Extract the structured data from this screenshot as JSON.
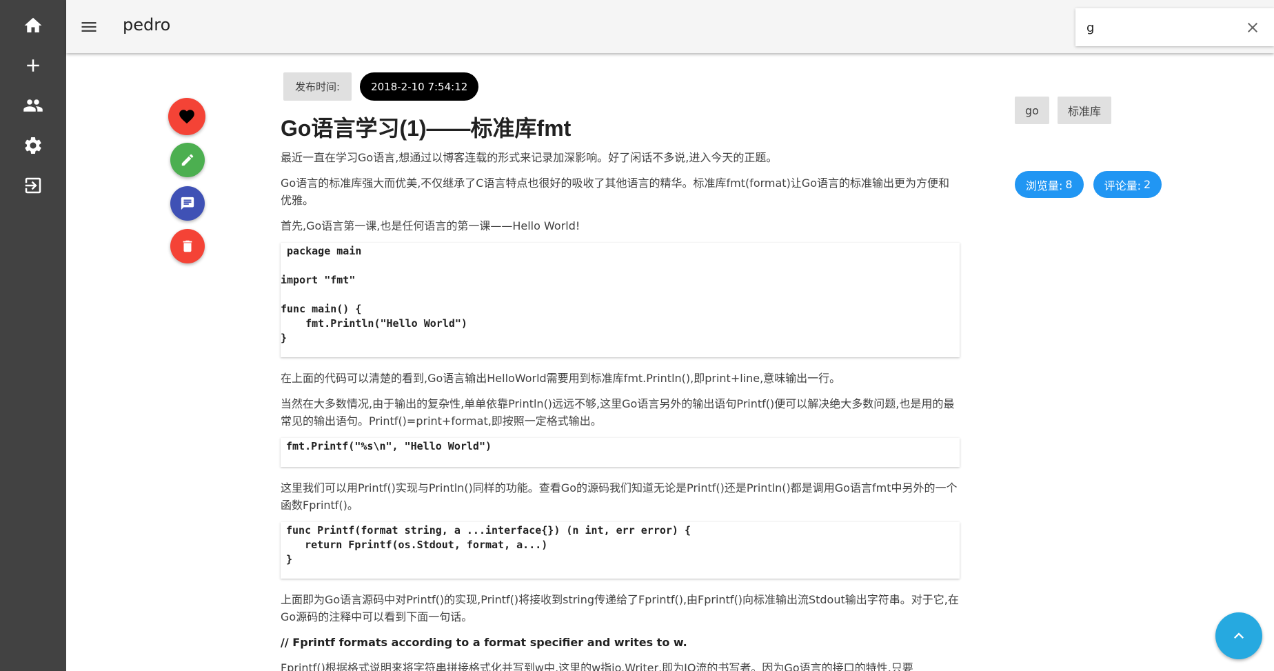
{
  "sidebar": {
    "items": [
      {
        "name": "home",
        "icon": "home-icon"
      },
      {
        "name": "add",
        "icon": "plus-icon"
      },
      {
        "name": "users",
        "icon": "people-icon"
      },
      {
        "name": "settings",
        "icon": "gear-icon"
      },
      {
        "name": "logout",
        "icon": "exit-icon"
      }
    ]
  },
  "header": {
    "title": "pedro",
    "search_value": "g"
  },
  "post": {
    "publish_label": "发布时间:",
    "publish_time": "2018-2-10 7:54:12",
    "title": "Go语言学习(1)——标准库fmt",
    "paragraphs": [
      "最近一直在学习Go语言,想通过以博客连载的形式来记录加深影响。好了闲话不多说,进入今天的正题。",
      "Go语言的标准库强大而优美,不仅继承了C语言特点也很好的吸收了其他语言的精华。标准库fmt(format)让Go语言的标准输出更为方便和优雅。",
      "首先,Go语言第一课,也是任何语言的第一课——Hello World!",
      "在上面的代码可以清楚的看到,Go语言输出HelloWorld需要用到标准库fmt.Println(),即print+line,意味输出一行。",
      "当然在大多数情况,由于输出的复杂性,单单依靠Println()远远不够,这里Go语言另外的输出语句Printf()便可以解决绝大多数问题,也是用的最常见的输出语句。Printf()=print+format,即按照一定格式输出。",
      "这里我们可以用Printf()实现与Println()同样的功能。查看Go的源码我们知道无论是Printf()还是Println()都是调用Go语言fmt中另外的一个函数Fprintf()。",
      "上面即为Go语言源码中对Printf()的实现,Printf()将接收到string传递给了Fprintf(),由Fprintf()向标准输出流Stdout输出字符串。对于它,在Go源码的注释中可以看到下面一句话。",
      "// Fprintf formats according to a format specifier and writes to w.",
      "Fprintf()根据格式说明来将字符串拼接格式化并写到w中,这里的w指io.Writer,即为IO流的书写者。因为Go语言的接口的特性,只要"
    ],
    "code_blocks": [
      " package main\n\nimport \"fmt\"\n\nfunc main() {\n    fmt.Println(\"Hello World\")\n}",
      "fmt.Printf(\"%s\\n\", \"Hello World\")",
      "func Printf(format string, a ...interface{}) (n int, err error) {\n   return Fprintf(os.Stdout, format, a...)\n}"
    ],
    "tags": [
      "go",
      "标准库"
    ],
    "views_label": "浏览量:",
    "views": "8",
    "comments_label": "评论量:",
    "comments": "2"
  },
  "actions": {
    "like": "heart-icon",
    "edit": "pencil-icon",
    "comment": "comment-icon",
    "delete": "trash-icon",
    "scroll_top": "chevron-up-icon"
  },
  "colors": {
    "sidebar_bg": "#424242",
    "like": "#f44336",
    "edit": "#4caf50",
    "comment": "#3f51b5",
    "delete": "#f44336",
    "stat": "#2196f3",
    "scroll_top": "#26a9e0"
  }
}
